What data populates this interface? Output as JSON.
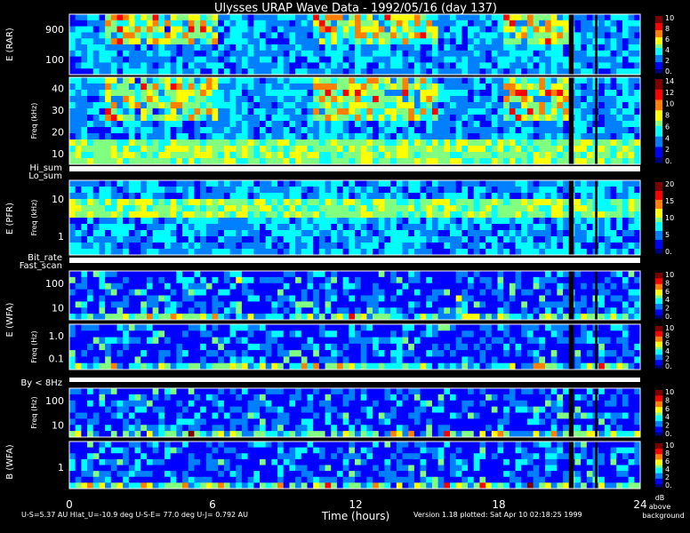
{
  "chart_data": {
    "type": "heatmap",
    "title": "Ulysses URAP Wave Data - 1992/05/16  (day 137)",
    "xlabel": "Time (hours)",
    "xlim": [
      0,
      24
    ],
    "x_ticks": [
      "0",
      "6",
      "12",
      "18",
      "24"
    ],
    "panels": [
      {
        "key": "rar_hi",
        "freq_label": "",
        "yscale": "log",
        "ylim": [
          40,
          1200
        ],
        "y_ticks": [
          "900",
          "100"
        ],
        "cb_ticks": [
          "10",
          "8",
          "6",
          "4",
          "2",
          "0."
        ]
      },
      {
        "key": "rar_lo",
        "freq_label": "Freq (kHz)",
        "yscale": "linear",
        "ylim": [
          1,
          50
        ],
        "y_ticks": [
          "40",
          "30",
          "20",
          "10"
        ],
        "cb_ticks": [
          "14",
          "12",
          "10",
          "8",
          "6",
          "4",
          "2",
          "0."
        ]
      },
      {
        "key": "pfr",
        "freq_label": "Freq (kHz)",
        "yscale": "log",
        "ylim": [
          0.6,
          30
        ],
        "y_ticks": [
          "10",
          "1"
        ],
        "cb_ticks": [
          "20",
          "15",
          "10",
          "5",
          "0."
        ]
      },
      {
        "key": "wfa_e_hi",
        "freq_label": "",
        "yscale": "log",
        "ylim": [
          8,
          500
        ],
        "y_ticks": [
          "100",
          "10"
        ],
        "cb_ticks": [
          "10",
          "8",
          "6",
          "4",
          "2",
          "0."
        ]
      },
      {
        "key": "wfa_e_lo",
        "freq_label": "Freq (Hz)",
        "yscale": "log",
        "ylim": [
          0.08,
          6
        ],
        "y_ticks": [
          "1.0",
          "0.1"
        ],
        "cb_ticks": [
          "10",
          "8",
          "6",
          "4",
          "2",
          "0."
        ]
      },
      {
        "key": "wfa_b_hi",
        "freq_label": "Freq (Hz)",
        "yscale": "log",
        "ylim": [
          8,
          500
        ],
        "y_ticks": [
          "100",
          "10"
        ],
        "cb_ticks": [
          "10",
          "8",
          "6",
          "4",
          "2",
          "0."
        ]
      },
      {
        "key": "wfa_b_lo",
        "freq_label": "",
        "yscale": "log",
        "ylim": [
          0.1,
          6
        ],
        "y_ticks": [
          "1"
        ],
        "cb_ticks": [
          "10",
          "8",
          "6",
          "4",
          "2",
          "0."
        ]
      }
    ],
    "group_labels": [
      "E (RAR)",
      "E (PFR)",
      "E (WFA)",
      "B (WFA)"
    ],
    "strip_labels": [
      "Hi_sum",
      "Lo_sum",
      "Bit_rate",
      "Fast_scan",
      "By < 8Hz"
    ],
    "colorbar_unit": [
      "dB",
      "above",
      "background"
    ],
    "data_gap_hours": [
      21.0,
      21.2
    ],
    "data_gap_hours_2": [
      22.1,
      22.2
    ],
    "colormap": [
      "#000080",
      "#0000ff",
      "#0080ff",
      "#00ffff",
      "#80ff80",
      "#ffff00",
      "#ff8000",
      "#ff0000",
      "#800000"
    ]
  },
  "footer": {
    "left": "U-S=5.37 AU  Hlat_U=-10.9 deg  U-S-E= 77.0 deg  U-J= 0.792 AU",
    "right": "Version 1.18 plotted: Sat Apr 10 02:18:25 1999"
  }
}
